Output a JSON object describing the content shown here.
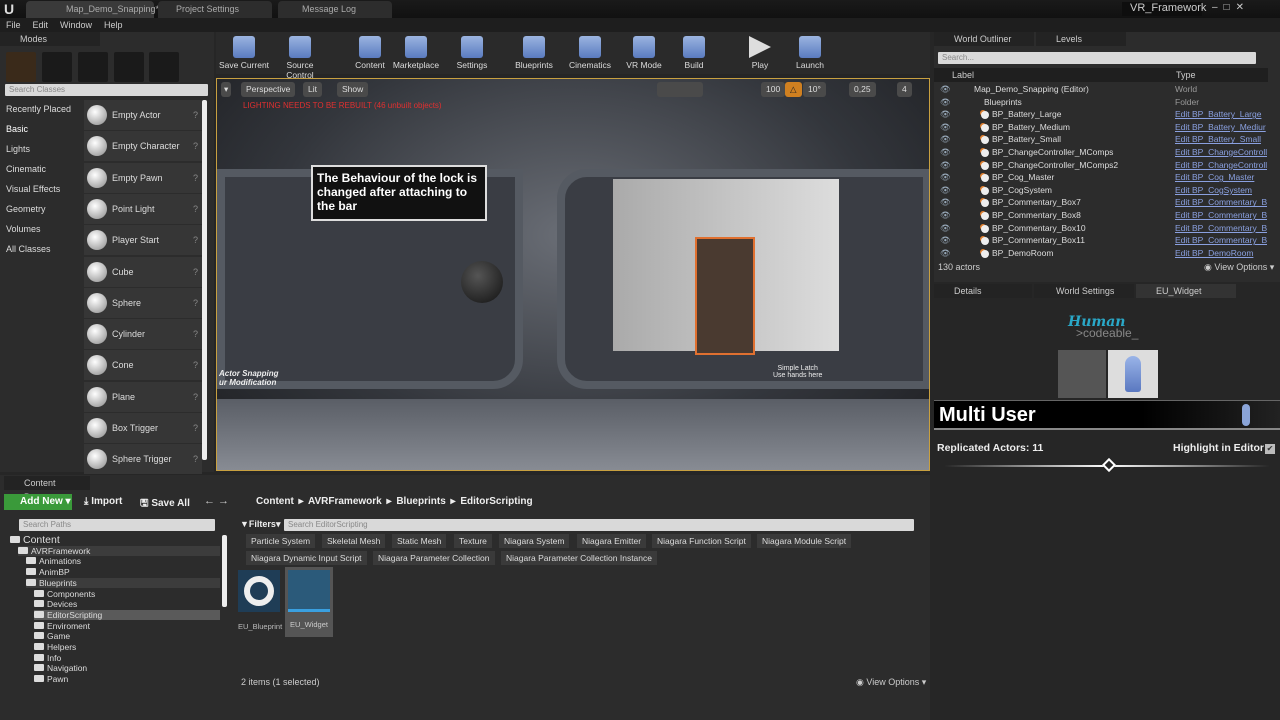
{
  "titlebar": {
    "tabs": [
      "Map_Demo_Snapping*",
      "Project Settings",
      "Message Log"
    ],
    "project": "VR_Framework"
  },
  "menu": [
    "File",
    "Edit",
    "Window",
    "Help"
  ],
  "modes": {
    "title": "Modes",
    "search_placeholder": "Search Classes",
    "categories": [
      "Recently Placed",
      "Basic",
      "Lights",
      "Cinematic",
      "Visual Effects",
      "Geometry",
      "Volumes",
      "All Classes"
    ],
    "items": [
      "Empty Actor",
      "Empty Character",
      "Empty Pawn",
      "Point Light",
      "Player Start",
      "Cube",
      "Sphere",
      "Cylinder",
      "Cone",
      "Plane",
      "Box Trigger",
      "Sphere Trigger"
    ]
  },
  "toolbar": [
    "Save Current",
    "Source Control",
    "Content",
    "Marketplace",
    "Settings",
    "Blueprints",
    "Cinematics",
    "VR Mode",
    "Build",
    "Play",
    "Launch"
  ],
  "viewport": {
    "perspective": "Perspective",
    "lit": "Lit",
    "show": "Show",
    "warning": "LIGHTING NEEDS TO BE REBUILT (46 unbuilt objects)",
    "grid": "100",
    "angle": "10°",
    "scale": "0,25",
    "cam": "4",
    "sign1": "The Behaviour of the lock is changed after attaching to the bar",
    "sign2a": "Actor Snapping",
    "sign2b": "ur Modification",
    "sign3a": "Simple Latch",
    "sign3b": "Use hands here"
  },
  "outliner": {
    "tabs": [
      "World Outliner",
      "Levels"
    ],
    "search_placeholder": "Search...",
    "col_label": "Label",
    "col_type": "Type",
    "rows": [
      {
        "label": "Map_Demo_Snapping (Editor)",
        "type": "World"
      },
      {
        "label": "Blueprints",
        "type": "Folder"
      },
      {
        "label": "BP_Battery_Large",
        "type": "Edit BP_Battery_Large"
      },
      {
        "label": "BP_Battery_Medium",
        "type": "Edit BP_Battery_Mediur"
      },
      {
        "label": "BP_Battery_Small",
        "type": "Edit BP_Battery_Small"
      },
      {
        "label": "BP_ChangeController_MComps",
        "type": "Edit BP_ChangeControll"
      },
      {
        "label": "BP_ChangeController_MComps2",
        "type": "Edit BP_ChangeControll"
      },
      {
        "label": "BP_Cog_Master",
        "type": "Edit BP_Cog_Master"
      },
      {
        "label": "BP_CogSystem",
        "type": "Edit BP_CogSystem"
      },
      {
        "label": "BP_Commentary_Box7",
        "type": "Edit BP_Commentary_B"
      },
      {
        "label": "BP_Commentary_Box8",
        "type": "Edit BP_Commentary_B"
      },
      {
        "label": "BP_Commentary_Box10",
        "type": "Edit BP_Commentary_B"
      },
      {
        "label": "BP_Commentary_Box11",
        "type": "Edit BP_Commentary_B"
      },
      {
        "label": "BP_DemoRoom",
        "type": "Edit BP_DemoRoom"
      }
    ],
    "count": "130 actors",
    "view_options": "View Options"
  },
  "details": {
    "tabs": [
      "Details",
      "World Settings",
      "EU_Widget"
    ],
    "logo_top": "Human",
    "logo_bottom": ">codeable_",
    "title": "Multi User",
    "replicated": "Replicated Actors: 11",
    "highlight": "Highlight in Editor",
    "highlight_checked": true
  },
  "content_browser": {
    "title": "Content Browser",
    "add_new": "Add New",
    "import": "Import",
    "save_all": "Save All",
    "breadcrumb": [
      "Content",
      "AVRFramework",
      "Blueprints",
      "EditorScripting"
    ],
    "search_paths": "Search Paths",
    "filters": "Filters",
    "search_assets": "Search EditorScripting",
    "filter_chips": [
      "Particle System",
      "Skeletal Mesh",
      "Static Mesh",
      "Texture",
      "Niagara System",
      "Niagara Emitter",
      "Niagara Function Script",
      "Niagara Module Script",
      "Niagara Dynamic Input Script",
      "Niagara Parameter Collection",
      "Niagara Parameter Collection Instance"
    ],
    "tree": [
      "Content",
      "AVRFramework",
      "Animations",
      "AnimBP",
      "Blueprints",
      "Components",
      "Devices",
      "EditorScripting",
      "Enviroment",
      "Game",
      "Helpers",
      "Info",
      "Navigation",
      "Pawn"
    ],
    "assets": [
      "EU_Blueprint",
      "EU_Widget"
    ],
    "status": "2 items (1 selected)",
    "view_options": "View Options"
  }
}
